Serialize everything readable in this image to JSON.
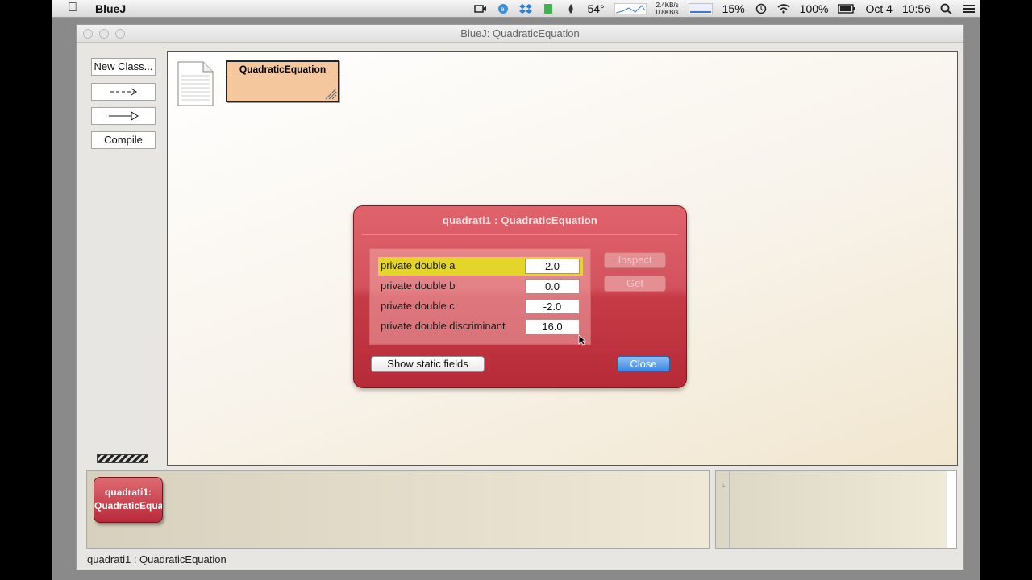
{
  "menubar": {
    "app_name": "BlueJ",
    "temperature": "54°",
    "net_up": "2.4KB/s",
    "net_down": "0.8KB/s",
    "cpu": "15%",
    "battery": "100%",
    "date": "Oct 4",
    "time": "10:56"
  },
  "window": {
    "title": "BlueJ:  QuadraticEquation"
  },
  "sidebar": {
    "new_class": "New Class...",
    "compile": "Compile"
  },
  "diagram": {
    "class_name": "QuadraticEquation"
  },
  "inspector": {
    "title": "quadrati1 : QuadraticEquation",
    "fields": [
      {
        "label": "private double a",
        "value": "2.0"
      },
      {
        "label": "private double b",
        "value": "0.0"
      },
      {
        "label": "private double c",
        "value": "-2.0"
      },
      {
        "label": "private double discriminant",
        "value": "16.0"
      }
    ],
    "inspect_label": "Inspect",
    "get_label": "Get",
    "static_label": "Show static fields",
    "close_label": "Close"
  },
  "object_bench": {
    "object_line1": "quadrati1:",
    "object_line2": "QuadraticEqua"
  },
  "status": "quadrati1 : QuadraticEquation"
}
